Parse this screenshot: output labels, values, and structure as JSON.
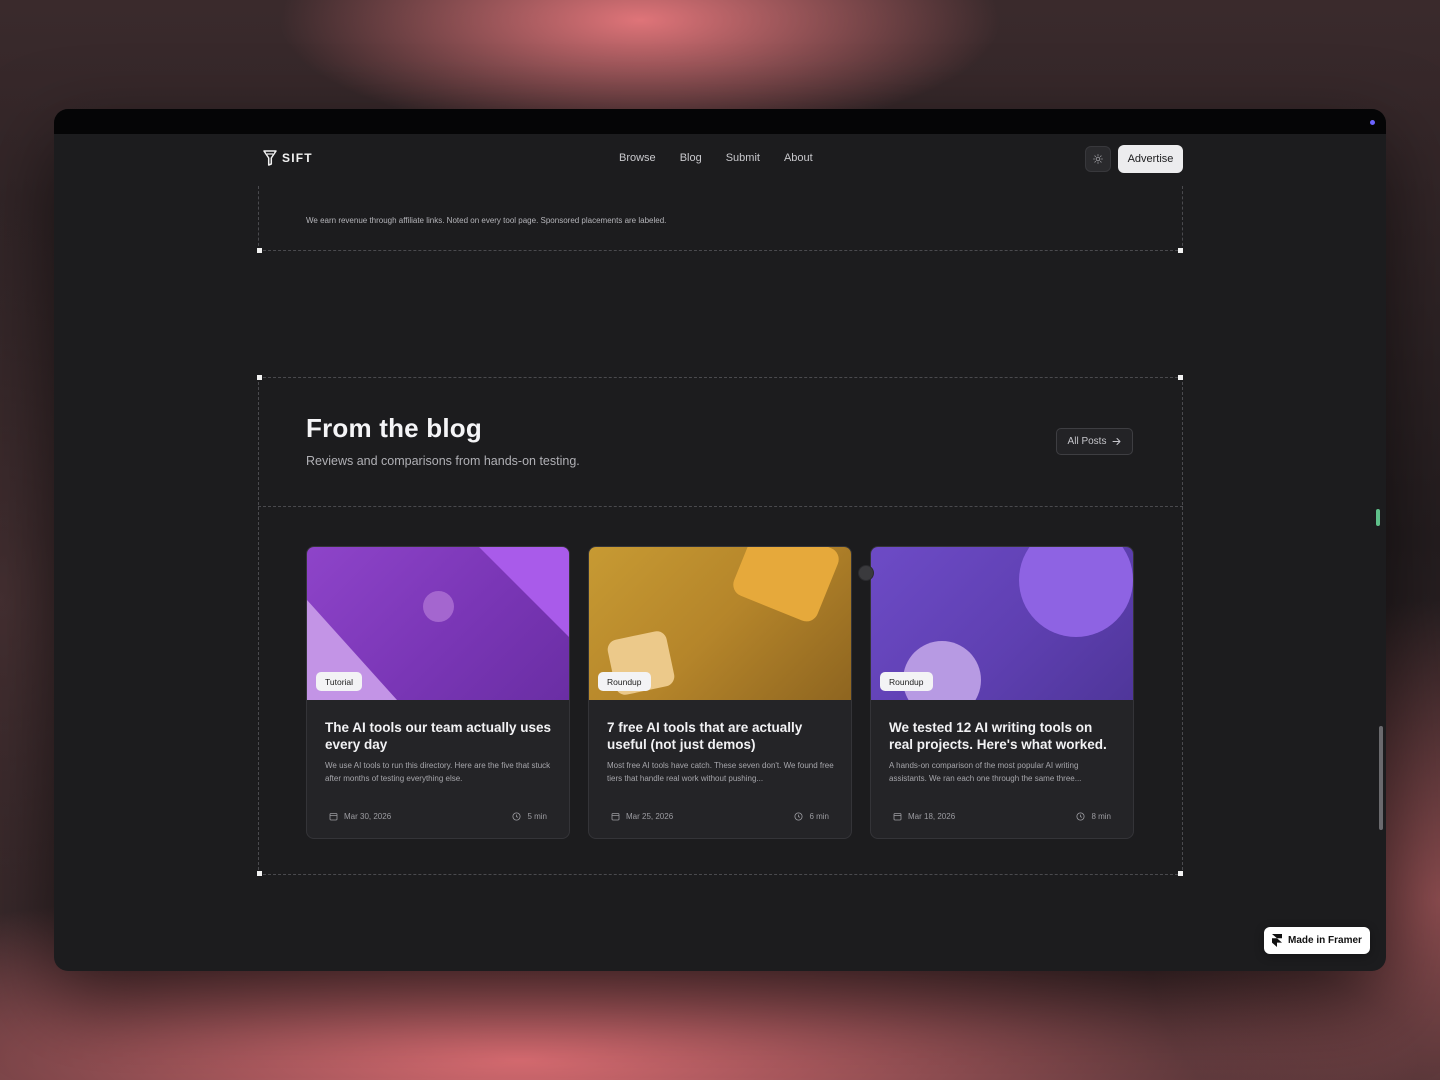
{
  "brand": {
    "name": "Sift"
  },
  "nav": {
    "links": [
      "Browse",
      "Blog",
      "Submit",
      "About"
    ],
    "advertise_label": "Advertise"
  },
  "disclosure": "We earn revenue through affiliate links. Noted on every tool page. Sponsored placements are labeled.",
  "blog": {
    "title": "From the blog",
    "subtitle": "Reviews and comparisons from hands-on testing.",
    "all_posts_label": "All Posts",
    "posts": [
      {
        "badge": "Tutorial",
        "title": "The AI tools our team actually uses every day",
        "excerpt": "We use AI tools to run this directory. Here are the five that stuck after months of testing everything else.",
        "date": "Mar 30, 2026",
        "read_time": "5 min"
      },
      {
        "badge": "Roundup",
        "title": "7 free AI tools that are actually useful (not just demos)",
        "excerpt": "Most free AI tools have catch. These seven don't. We found free tiers that handle real work without pushing...",
        "date": "Mar 25, 2026",
        "read_time": "6 min"
      },
      {
        "badge": "Roundup",
        "title": "We tested 12 AI writing tools on real projects. Here's what worked.",
        "excerpt": "A hands-on comparison of the most popular AI writing assistants. We ran each one through the same three...",
        "date": "Mar 18, 2026",
        "read_time": "8 min"
      }
    ]
  },
  "framer_badge": "Made in Framer",
  "colors": {
    "page_bg": "#1c1c1e",
    "card_bg": "#242427",
    "accent_pink": "#e8787d",
    "card1_purple": "#8a3fc4",
    "card2_gold": "#c4922c",
    "card3_violet": "#6a4bc4"
  }
}
